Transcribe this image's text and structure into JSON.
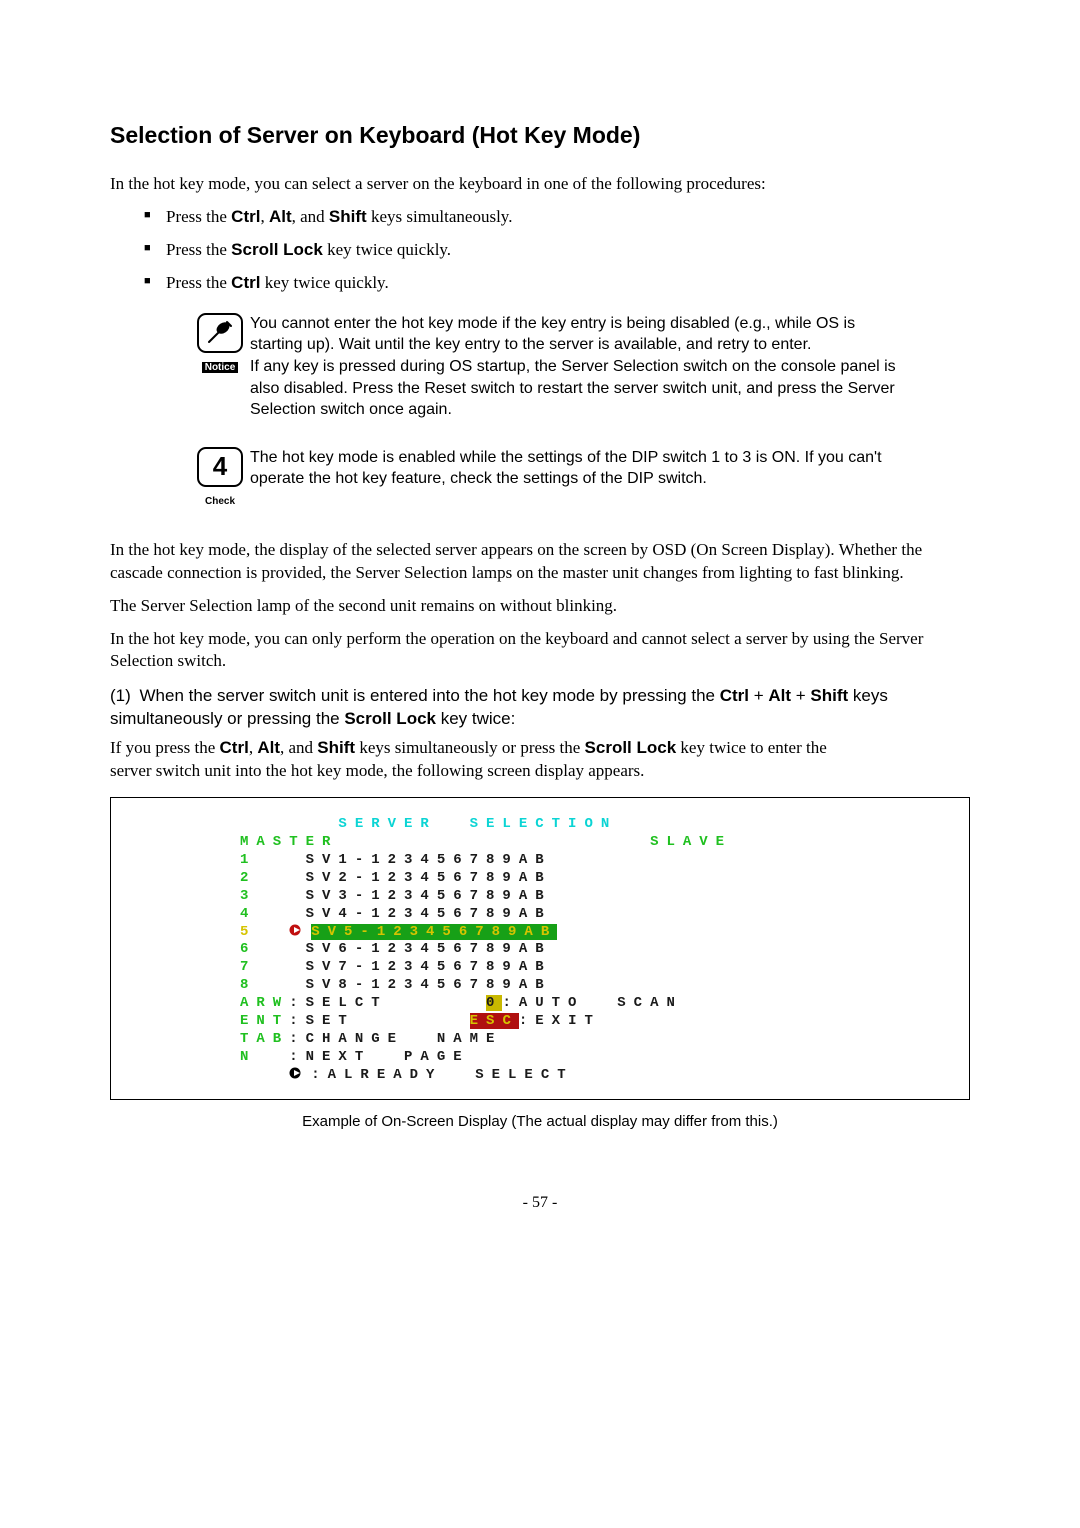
{
  "title": "Selection of Server on Keyboard (Hot Key Mode)",
  "intro": "In the hot key mode, you can select a server on the keyboard in one of the following procedures:",
  "bullets": {
    "b1_pre": "Press the ",
    "b1_k1": "Ctrl",
    "b1_sep1": ", ",
    "b1_k2": "Alt",
    "b1_sep2": ", and ",
    "b1_k3": "Shift",
    "b1_post": " keys simultaneously.",
    "b2_pre": "Press the ",
    "b2_k1": "Scroll Lock",
    "b2_post": " key twice quickly.",
    "b3_pre": "Press the ",
    "b3_k1": "Ctrl",
    "b3_post": " key twice quickly."
  },
  "notice": {
    "label": "Notice",
    "text1": "You cannot enter the hot key mode if the key entry is being disabled (e.g., while OS is starting up).    Wait until the key entry to the server is available, and retry to enter.",
    "text2": "If any key is pressed during OS startup, the Server Selection switch on the console panel is also disabled.    Press the Reset switch to restart the server switch unit, and press the Server Selection switch once again."
  },
  "check": {
    "glyph": "4",
    "label": "Check",
    "text": "The hot key mode is enabled while the settings of the DIP switch 1 to 3 is ON. If you can't operate the hot key feature, check the settings of the DIP switch."
  },
  "para1": "In the hot key mode, the display of the selected server appears on the screen by OSD (On Screen Display).    Whether the cascade connection is provided, the Server Selection lamps on the master unit changes from lighting to fast blinking.",
  "para2": "The Server Selection lamp of the second unit remains on without blinking.",
  "para3": "In the hot key mode, you can only perform the operation on the keyboard and cannot select a server by using the Server Selection switch.",
  "proc1": {
    "num": "(1)",
    "pre": " When the server switch unit is entered into the hot key mode by pressing the ",
    "k1": "Ctrl",
    "plus1": " + ",
    "k2": "Alt",
    "plus2": " + ",
    "k3": "Shift",
    "mid": " keys simultaneously or pressing the ",
    "k4": "Scroll Lock",
    "post": " key twice:",
    "sub_pre": "If you press the ",
    "sub_k1": "Ctrl",
    "sub_s1": ", ",
    "sub_k2": "Alt",
    "sub_s2": ", and ",
    "sub_k3": "Shift",
    "sub_mid": " keys simultaneously or press the ",
    "sub_k4": "Scroll Lock",
    "sub_post": " key twice to enter the server switch unit into the hot key mode, the following screen display appears."
  },
  "osd": {
    "title": "SERVER  SELECTION",
    "hdr_master": "MASTER",
    "hdr_slave": "SLAVE",
    "rows": [
      {
        "i": "1",
        "name": "SV1-123456789AB",
        "sel": false
      },
      {
        "i": "2",
        "name": "SV2-123456789AB",
        "sel": false
      },
      {
        "i": "3",
        "name": "SV3-123456789AB",
        "sel": false
      },
      {
        "i": "4",
        "name": "SV4-123456789AB",
        "sel": false
      },
      {
        "i": "5",
        "name": "SV5-123456789AB",
        "sel": true
      },
      {
        "i": "6",
        "name": "SV6-123456789AB",
        "sel": false
      },
      {
        "i": "7",
        "name": "SV7-123456789AB",
        "sel": false
      },
      {
        "i": "8",
        "name": "SV8-123456789AB",
        "sel": false
      }
    ],
    "legend": {
      "l1a": "ARW",
      "l1b": ":SELCT",
      "l1c": "0",
      "l1d": ":AUTO  SCAN",
      "l2a": "ENT",
      "l2b": ":SET",
      "l2c": "ESC",
      "l2d": ":EXIT",
      "l3a": "TAB",
      "l3b": ":CHANGE  NAME",
      "l4a": "N",
      "l4b": ":NEXT  PAGE",
      "l5b": ":ALREADY  SELECT"
    }
  },
  "caption": "Example of On-Screen Display (The actual display may differ from this.)",
  "page": "- 57 -"
}
